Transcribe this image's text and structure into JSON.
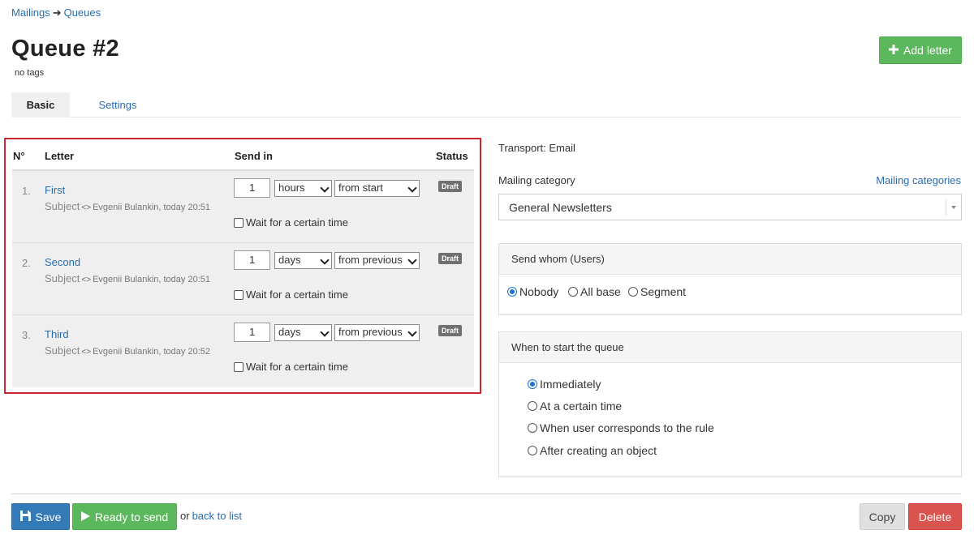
{
  "breadcrumb": {
    "mailings": "Mailings",
    "separator": "➜",
    "queues": "Queues"
  },
  "page": {
    "title": "Queue #2",
    "tags": "no tags"
  },
  "header": {
    "add_letter_label": "Add letter"
  },
  "tabs": [
    {
      "label": "Basic",
      "active": true
    },
    {
      "label": "Settings",
      "active": false
    }
  ],
  "letters": {
    "columns": {
      "num": "N°",
      "letter": "Letter",
      "send_in": "Send in",
      "status": "Status"
    },
    "rows": [
      {
        "num": "1.",
        "name": "First",
        "subject": "Subject",
        "author": "Evgenii Bulankin, today 20:51",
        "amount": "1",
        "unit": "hours",
        "from": "from start",
        "wait_label": "Wait for a certain time",
        "status": "Draft"
      },
      {
        "num": "2.",
        "name": "Second",
        "subject": "Subject",
        "author": "Evgenii Bulankin, today 20:51",
        "amount": "1",
        "unit": "days",
        "from": "from previous",
        "wait_label": "Wait for a certain time",
        "status": "Draft"
      },
      {
        "num": "3.",
        "name": "Third",
        "subject": "Subject",
        "author": "Evgenii Bulankin, today 20:52",
        "amount": "1",
        "unit": "days",
        "from": "from previous",
        "wait_label": "Wait for a certain time",
        "status": "Draft"
      }
    ]
  },
  "settings": {
    "transport": "Transport: Email",
    "category_label": "Mailing category",
    "category_link": "Mailing categories",
    "category_value": "General Newsletters",
    "whom": {
      "title": "Send whom (Users)",
      "options": [
        {
          "label": "Nobody",
          "selected": true
        },
        {
          "label": "All base",
          "selected": false
        },
        {
          "label": "Segment",
          "selected": false
        }
      ]
    },
    "when": {
      "title": "When to start the queue",
      "options": [
        {
          "label": "Immediately",
          "selected": true
        },
        {
          "label": "At a certain time",
          "selected": false
        },
        {
          "label": "When user corresponds to the rule",
          "selected": false
        },
        {
          "label": "After creating an object",
          "selected": false
        }
      ]
    }
  },
  "footer": {
    "save_label": "Save",
    "ready_label": "Ready to send",
    "or_text": "or",
    "back_link": "back to list",
    "copy_label": "Copy",
    "delete_label": "Delete"
  },
  "colors": {
    "link": "#2a6cb0",
    "green": "#5cb85c",
    "blue": "#337ab7",
    "red": "#d9534f",
    "highlight_border": "#c9282d",
    "draft_badge": "#707070"
  },
  "icons": {
    "add_letter": "plus-icon",
    "save": "floppy-disk-icon",
    "ready": "play-icon",
    "subject_code": "code-icon",
    "category_dropdown": "caret-down-icon"
  }
}
